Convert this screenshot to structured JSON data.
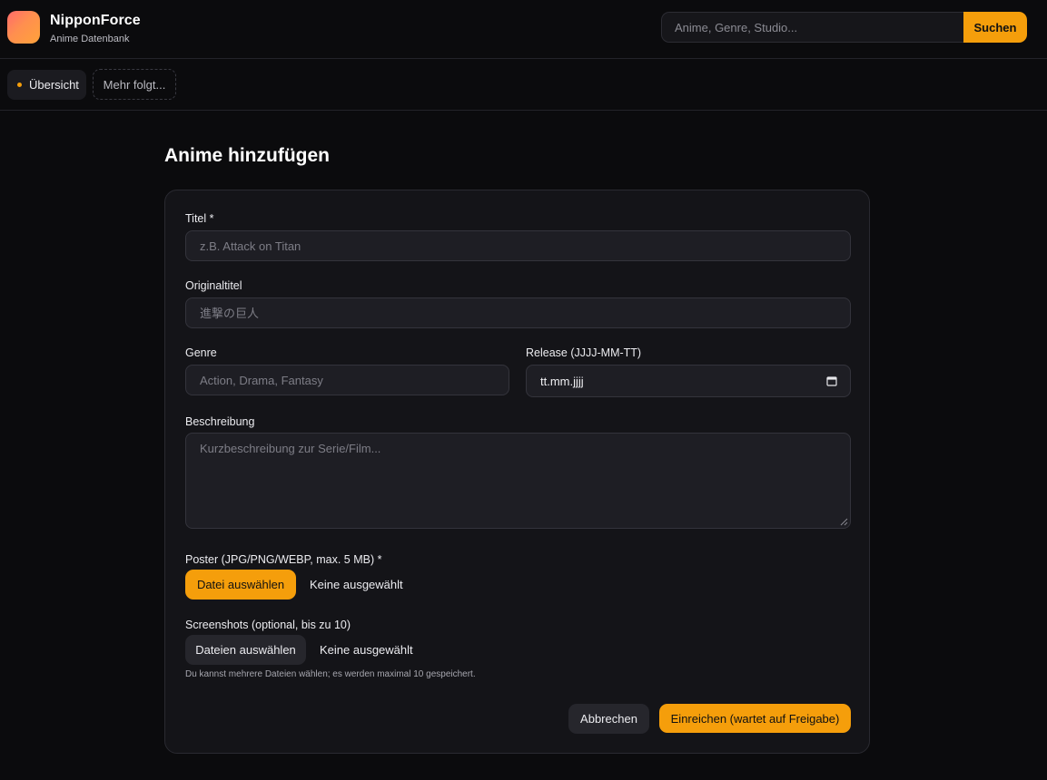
{
  "header": {
    "brand_name": "NipponForce",
    "brand_sub": "Anime Datenbank",
    "search_placeholder": "Anime, Genre, Studio...",
    "search_button": "Suchen"
  },
  "nav": {
    "tabs": [
      {
        "label": "Übersicht",
        "active": true
      },
      {
        "label": "Mehr folgt...",
        "active": false
      }
    ]
  },
  "page": {
    "title": "Anime hinzufügen"
  },
  "form": {
    "title_label": "Titel *",
    "title_placeholder": "z.B. Attack on Titan",
    "original_label": "Originaltitel",
    "original_placeholder": "進撃の巨人",
    "genre_label": "Genre",
    "genre_placeholder": "Action, Drama, Fantasy",
    "release_label": "Release (JJJJ-MM-TT)",
    "release_value": "tt.mm.jjjj",
    "description_label": "Beschreibung",
    "description_placeholder": "Kurzbeschreibung zur Serie/Film...",
    "poster_label": "Poster (JPG/PNG/WEBP, max. 5 MB) *",
    "poster_button": "Datei auswählen",
    "poster_status": "Keine ausgewählt",
    "screenshots_label": "Screenshots (optional, bis zu 10)",
    "screenshots_button": "Dateien auswählen",
    "screenshots_status": "Keine ausgewählt",
    "screenshots_hint": "Du kannst mehrere Dateien wählen; es werden maximal 10 gespeichert.",
    "cancel_button": "Abbrechen",
    "submit_button": "Einreichen (wartet auf Freigabe)"
  },
  "colors": {
    "accent": "#f59e0b",
    "background": "#0b0b0d",
    "card": "#141418"
  },
  "icons": [
    "calendar-icon",
    "resize-handle-icon"
  ]
}
